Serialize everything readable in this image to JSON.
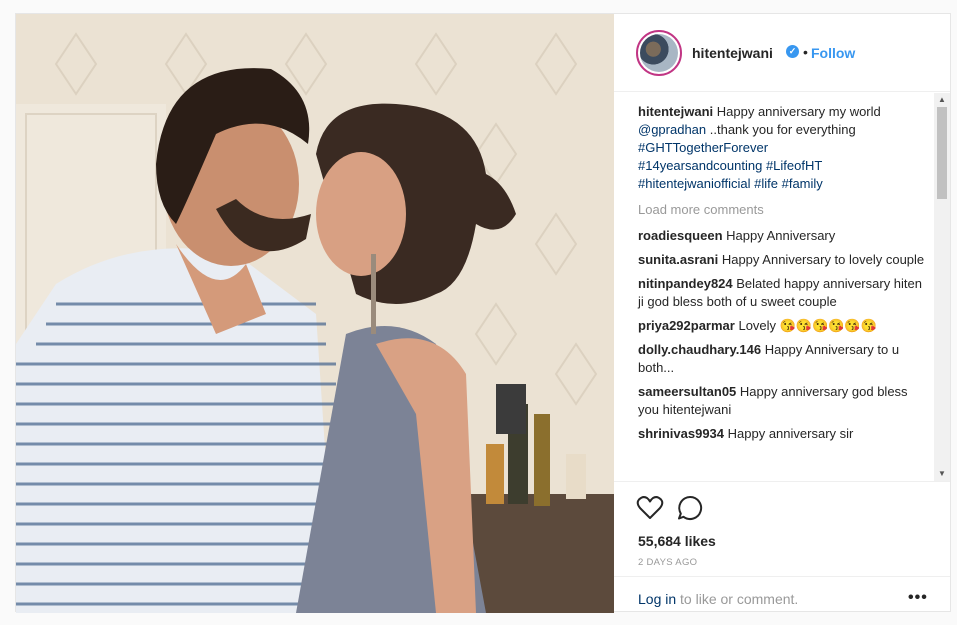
{
  "post": {
    "username": "hitentejwani",
    "verified_icon": "verified-badge-icon",
    "dot": "•",
    "follow_label": "Follow",
    "caption": {
      "username": "hitentejwani",
      "text1": "Happy anniversary my world",
      "mention": "@gpradhan",
      "text2": "..thank you for everything",
      "tag1": "#GHTTogetherForever",
      "tag2": "#14yearsandcounting",
      "tag3": "#LifeofHT",
      "tag4": "#hitentejwaniofficial",
      "tag5": "#life",
      "tag6": "#family"
    },
    "load_more": "Load more comments",
    "comments": [
      {
        "user": "roadiesqueen",
        "text": "Happy Anniversary"
      },
      {
        "user": "sunita.asrani",
        "text": "Happy Anniversary to lovely couple"
      },
      {
        "user": "nitinpandey824",
        "text": "Belated happy anniversary hiten ji god bless both of u sweet couple"
      },
      {
        "user": "priya292parmar",
        "text": "Lovely 😘😘😘😘😘😘"
      },
      {
        "user": "dolly.chaudhary.146",
        "text": "Happy Anniversary to u both..."
      },
      {
        "user": "sameersultan05",
        "text": "Happy anniversary god bless you hitentejwani"
      },
      {
        "user": "shrinivas9934",
        "text": "Happy anniversary sir"
      }
    ],
    "likes": "55,684 likes",
    "time": "2 DAYS AGO",
    "login_link": "Log in",
    "login_text": " to like or comment.",
    "more_label": "•••",
    "colors": {
      "link": "#3897f0",
      "hashtag": "#003569",
      "muted": "#999999"
    }
  }
}
